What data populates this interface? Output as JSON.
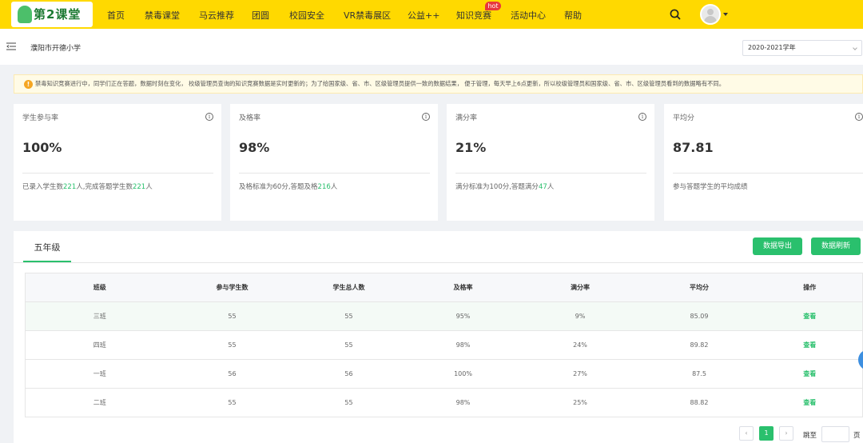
{
  "header": {
    "logo_text": "第2课堂",
    "nav": [
      "首页",
      "禁毒课堂",
      "马云推荐",
      "团圆",
      "校园安全",
      "VR禁毒展区",
      "公益++",
      "知识竞赛",
      "活动中心",
      "帮助"
    ],
    "hot_badge": "hot"
  },
  "subbar": {
    "school": "濮阳市开德小学",
    "year": "2020-2021学年"
  },
  "notice": {
    "icon": "!",
    "text": "禁毒知识竞赛进行中，同学们正在答题，数据时刻在变化， 校级管理员查询的知识竞赛数据是实时更新的；为了给国家级、省、市、区级管理员提供一致的数据结果， 便于管理，每天早上6点更新，所以校级管理员和国家级、省、市、区级管理员看到的数据略有不同。"
  },
  "stats": [
    {
      "title": "学生参与率",
      "value": "100%",
      "d1": "已录入学生数",
      "n1": "221",
      "d2": "人,完成答题学生数",
      "n2": "221",
      "d3": "人"
    },
    {
      "title": "及格率",
      "value": "98%",
      "d1": "及格标准为60分,答题及格",
      "n1": "216",
      "d2": "人",
      "n2": "",
      "d3": ""
    },
    {
      "title": "满分率",
      "value": "21%",
      "d1": "满分标准为100分,答题满分",
      "n1": "47",
      "d2": "人",
      "n2": "",
      "d3": ""
    },
    {
      "title": "平均分",
      "value": "87.81",
      "d1": "参与答题学生的平均成绩",
      "n1": "",
      "d2": "",
      "n2": "",
      "d3": ""
    }
  ],
  "info_icon": "i",
  "panel": {
    "tab": "五年级",
    "export_btn": "数据导出",
    "refresh_btn": "数据刷新"
  },
  "table": {
    "headers": [
      "班级",
      "参与学生数",
      "学生总人数",
      "及格率",
      "满分率",
      "平均分",
      "操作"
    ],
    "rows": [
      [
        "三班",
        "55",
        "55",
        "95%",
        "9%",
        "85.09",
        "查看"
      ],
      [
        "四班",
        "55",
        "55",
        "98%",
        "24%",
        "89.82",
        "查看"
      ],
      [
        "一班",
        "56",
        "56",
        "100%",
        "27%",
        "87.5",
        "查看"
      ],
      [
        "二班",
        "55",
        "55",
        "98%",
        "25%",
        "88.82",
        "查看"
      ]
    ]
  },
  "pagination": {
    "prev": "‹",
    "current": "1",
    "next": "›",
    "goto": "跳至",
    "page": "页"
  },
  "colors": {
    "brand_yellow": "#ffd900",
    "accent_green": "#2ac06d",
    "hot_red": "#e8383d"
  }
}
